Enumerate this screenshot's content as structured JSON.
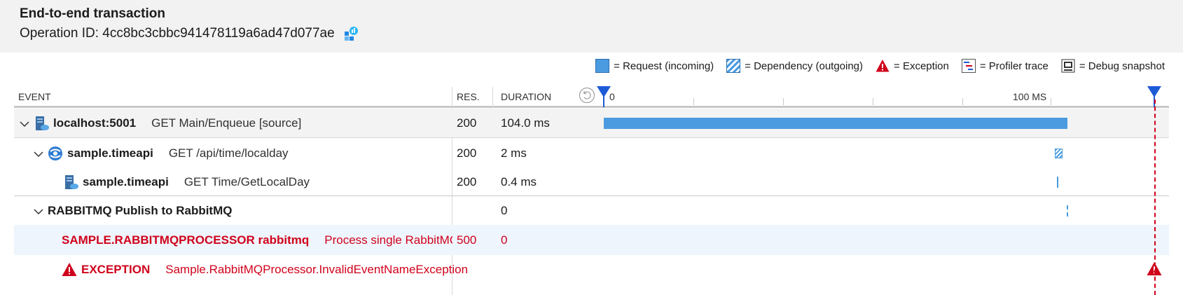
{
  "header": {
    "title": "End-to-end transaction",
    "operation_id": "Operation ID: 4cc8bc3cbbc941478119a6ad47d077ae"
  },
  "legend": {
    "request": "= Request (incoming)",
    "dependency": "= Dependency (outgoing)",
    "exception": "= Exception",
    "profiler": "= Profiler trace",
    "debug": "= Debug snapshot"
  },
  "columns": {
    "event": "EVENT",
    "res": "RES.",
    "duration": "DURATION",
    "tick_start": "0",
    "tick_end": "100 MS"
  },
  "rows": [
    {
      "name": "localhost:5001",
      "desc": "GET Main/Enqueue [source]",
      "res": "200",
      "duration": "104.0 ms"
    },
    {
      "name": "sample.timeapi",
      "desc": "GET /api/time/localday",
      "res": "200",
      "duration": "2 ms"
    },
    {
      "name": "sample.timeapi",
      "desc": "GET Time/GetLocalDay",
      "res": "200",
      "duration": "0.4 ms"
    },
    {
      "name": "RABBITMQ Publish to RabbitMQ",
      "desc": "",
      "res": "",
      "duration": "0"
    },
    {
      "name": "SAMPLE.RABBITMQPROCESSOR rabbitmq",
      "desc": "Process single RabbitMQ me",
      "res": "500",
      "duration": "0"
    },
    {
      "name": "EXCEPTION",
      "desc": "Sample.RabbitMQProcessor.InvalidEventNameException",
      "res": "",
      "duration": ""
    }
  ],
  "colors": {
    "accent": "#4a9be0",
    "error": "#d0021b",
    "marker": "#1e5bd6"
  }
}
